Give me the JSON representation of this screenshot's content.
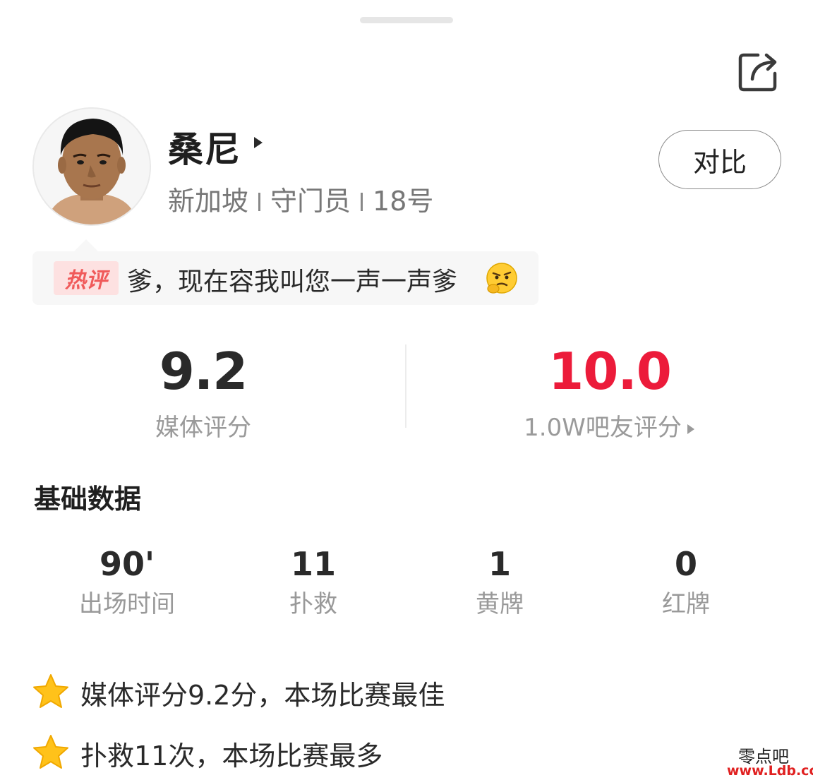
{
  "player": {
    "name": "桑尼",
    "country": "新加坡",
    "position": "守门员",
    "number": "18号"
  },
  "compare_button": "对比",
  "hot_comment": {
    "badge": "热评",
    "text": "爹，现在容我叫您一声一声爹",
    "emoji": "thinking-face-icon"
  },
  "ratings": {
    "media": {
      "value": "9.2",
      "label": "媒体评分"
    },
    "fans": {
      "value": "10.0",
      "label": "1.0W吧友评分"
    }
  },
  "basic_stats": {
    "title": "基础数据",
    "items": [
      {
        "value": "90'",
        "label": "出场时间"
      },
      {
        "value": "11",
        "label": "扑救"
      },
      {
        "value": "1",
        "label": "黄牌"
      },
      {
        "value": "0",
        "label": "红牌"
      }
    ]
  },
  "highlights": [
    {
      "icon": "star-icon",
      "text": "媒体评分9.2分，本场比赛最佳"
    },
    {
      "icon": "star-icon",
      "text": "扑救11次，本场比赛最多"
    }
  ],
  "watermark": {
    "name": "零点吧",
    "url": "www.Ldb.cc"
  },
  "colors": {
    "fan_rating": "#ec1b3a",
    "hot_badge_bg": "#fde1e1",
    "hot_badge_text": "#f05a5a",
    "star": "#ffc21a"
  }
}
